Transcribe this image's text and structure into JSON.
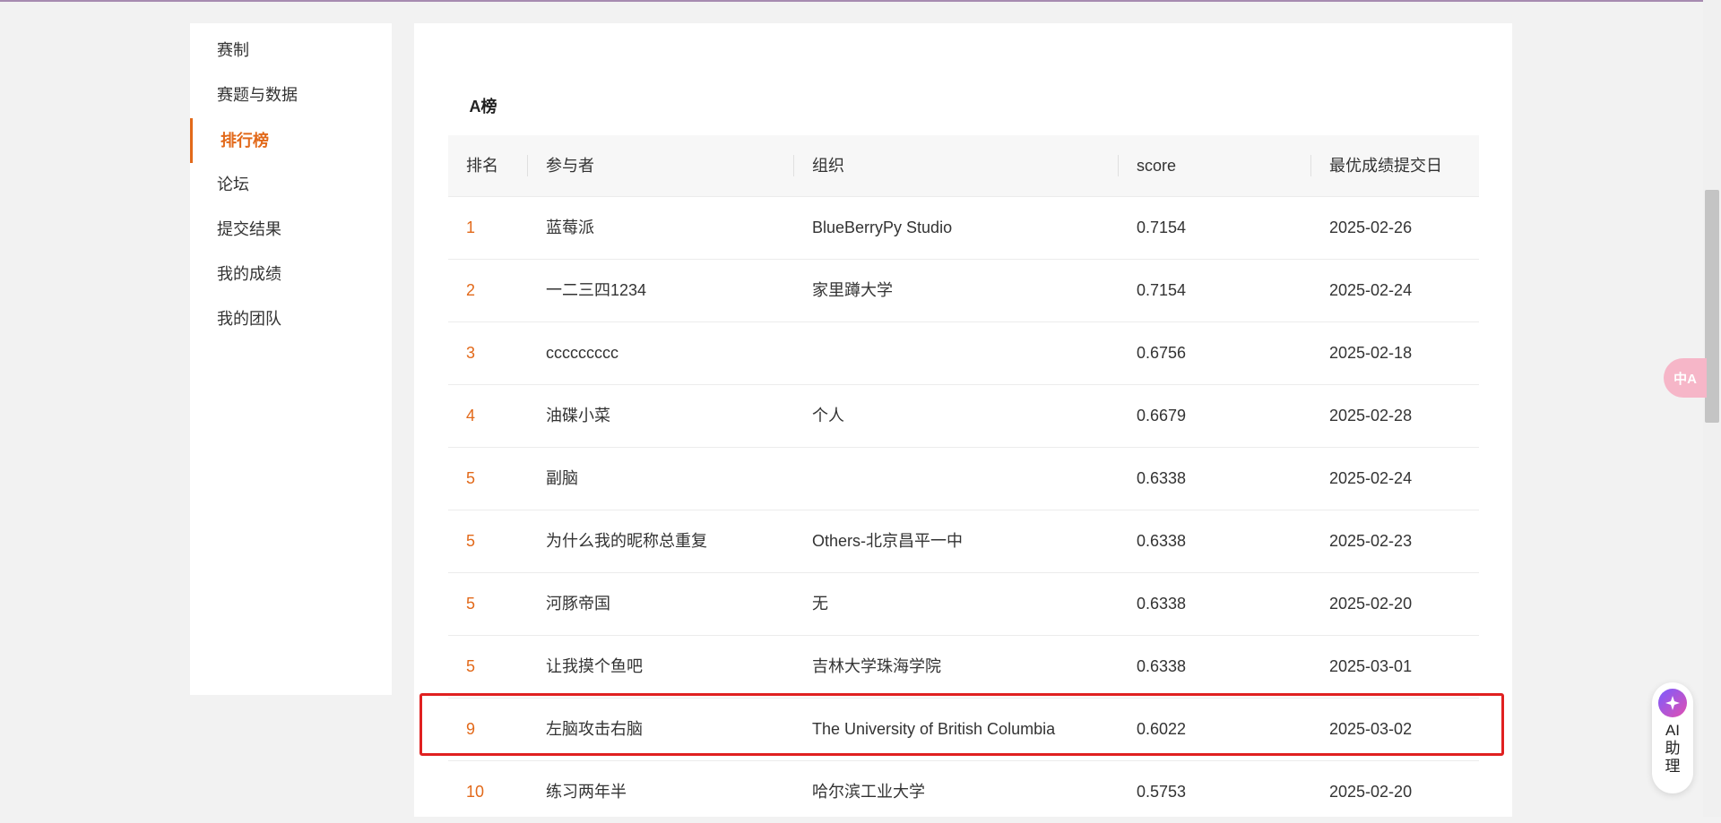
{
  "sidebar": {
    "items": [
      {
        "label": "赛制"
      },
      {
        "label": "赛题与数据"
      },
      {
        "label": "排行榜",
        "active": true
      },
      {
        "label": "论坛"
      },
      {
        "label": "提交结果"
      },
      {
        "label": "我的成绩"
      },
      {
        "label": "我的团队"
      }
    ]
  },
  "tabs": [
    {
      "label": "A榜"
    }
  ],
  "table": {
    "headers": {
      "rank": "排名",
      "participant": "参与者",
      "org": "组织",
      "score": "score",
      "date": "最优成绩提交日"
    },
    "rows": [
      {
        "rank": "1",
        "participant": "蓝莓派",
        "org": "BlueBerryPy Studio",
        "score": "0.7154",
        "date": "2025-02-26"
      },
      {
        "rank": "2",
        "participant": "一二三四1234",
        "org": "家里蹲大学",
        "score": "0.7154",
        "date": "2025-02-24"
      },
      {
        "rank": "3",
        "participant": "ccccccccc",
        "org": "",
        "score": "0.6756",
        "date": "2025-02-18"
      },
      {
        "rank": "4",
        "participant": "油碟小菜",
        "org": "个人",
        "score": "0.6679",
        "date": "2025-02-28"
      },
      {
        "rank": "5",
        "participant": "副脑",
        "org": "",
        "score": "0.6338",
        "date": "2025-02-24"
      },
      {
        "rank": "5",
        "participant": "为什么我的昵称总重复",
        "org": "Others-北京昌平一中",
        "score": "0.6338",
        "date": "2025-02-23"
      },
      {
        "rank": "5",
        "participant": "河豚帝国",
        "org": "无",
        "score": "0.6338",
        "date": "2025-02-20"
      },
      {
        "rank": "5",
        "participant": "让我摸个鱼吧",
        "org": "吉林大学珠海学院",
        "score": "0.6338",
        "date": "2025-03-01"
      },
      {
        "rank": "9",
        "participant": "左脑攻击右脑",
        "org": "The University of British Columbia",
        "score": "0.6022",
        "date": "2025-03-02",
        "highlighted": true
      },
      {
        "rank": "10",
        "participant": "练习两年半",
        "org": "哈尔滨工业大学",
        "score": "0.5753",
        "date": "2025-02-20"
      }
    ]
  },
  "floating": {
    "translate_icon": "translate-icon",
    "translate_glyph": "中A",
    "ai_label": "AI\n助\n理",
    "ai_icon": "ai-assistant-icon"
  },
  "colors": {
    "accent": "#e2691a",
    "highlight_border": "#e02020",
    "background": "#f2f2f2"
  }
}
